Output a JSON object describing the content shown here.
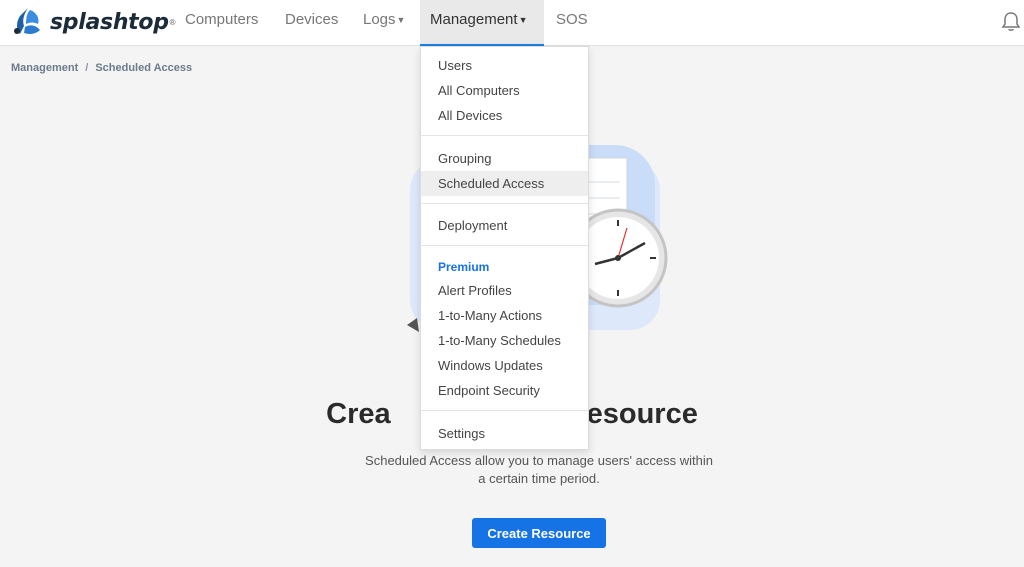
{
  "brand": {
    "name": "splashtop",
    "reg": "®"
  },
  "nav": {
    "computers": "Computers",
    "devices": "Devices",
    "logs": "Logs",
    "management": "Management",
    "sos": "SOS"
  },
  "breadcrumb": {
    "parent": "Management",
    "separator": "/",
    "current": "Scheduled Access"
  },
  "empty_state": {
    "title_left": "Crea",
    "title_right": "Resource",
    "description": "Scheduled Access allow you to manage users' access within a certain time period.",
    "button": "Create Resource"
  },
  "menu": {
    "group1": [
      "Users",
      "All Computers",
      "All Devices"
    ],
    "group2": [
      "Grouping",
      "Scheduled Access"
    ],
    "group3": [
      "Deployment"
    ],
    "premium_header": "Premium",
    "group4": [
      "Alert Profiles",
      "1-to-Many Actions",
      "1-to-Many Schedules",
      "Windows Updates",
      "Endpoint Security"
    ],
    "group5": [
      "Settings"
    ],
    "highlighted": "Scheduled Access"
  },
  "colors": {
    "accent": "#1673e6",
    "brand_dark": "#1c2b3a",
    "premium": "#1673e6"
  }
}
